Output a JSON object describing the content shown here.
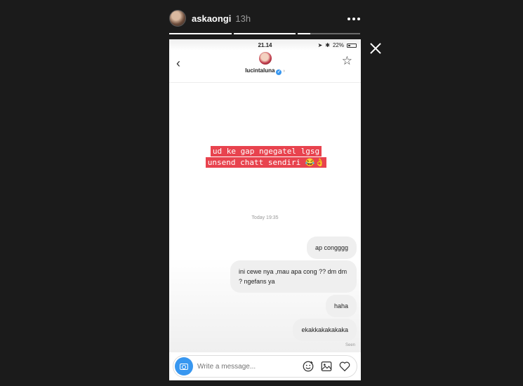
{
  "story": {
    "username": "askaongi",
    "time": "13h",
    "progress": [
      1.0,
      1.0,
      0.2
    ]
  },
  "phone": {
    "status_time": "21.14",
    "battery": "22%",
    "contact": "lucintaluna"
  },
  "caption": {
    "line1": "ud ke gap ngegatel lgsg",
    "line2": "unsend chatt sendiri 😂👌"
  },
  "chat": {
    "timestamp": "Today 19:35",
    "messages": [
      "ap congggg",
      "ini cewe nya ,mau apa cong ?? dm dm ? ngefans ya",
      "haha",
      "ekakkakakakaka"
    ],
    "seen": "Seen"
  },
  "composer": {
    "placeholder": "Write a message..."
  },
  "colors": {
    "caption_bg": "#e8434e",
    "bubble_bg": "#efefef",
    "accent": "#3897f0"
  }
}
